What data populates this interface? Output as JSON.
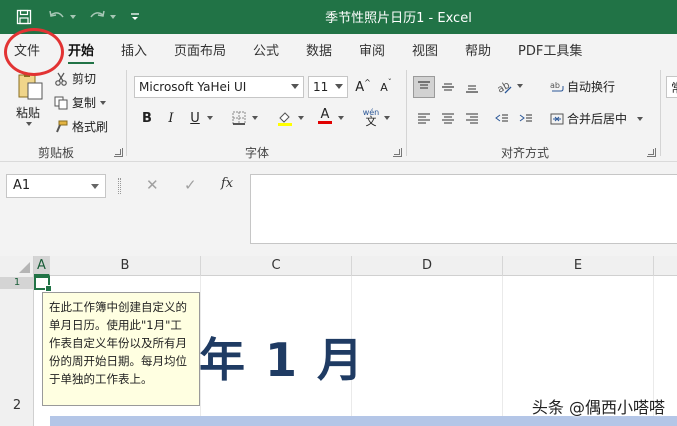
{
  "titlebar": {
    "title": "季节性照片日历1  -  Excel"
  },
  "tabs": [
    "文件",
    "开始",
    "插入",
    "页面布局",
    "公式",
    "数据",
    "审阅",
    "视图",
    "帮助",
    "PDF工具集"
  ],
  "clipboard": {
    "paste": "粘贴",
    "cut": "剪切",
    "copy": "复制",
    "format_painter": "格式刷",
    "group_label": "剪贴板"
  },
  "font": {
    "font_name": "Microsoft YaHei UI",
    "font_size": "11",
    "bold": "B",
    "italic": "I",
    "underline": "U",
    "phonetic": "wén",
    "group_label": "字体"
  },
  "alignment": {
    "wrap_text": "自动换行",
    "merge_center": "合并后居中",
    "group_label": "对齐方式",
    "number_format_partial": "常"
  },
  "formula_bar": {
    "name_box": "A1",
    "fx": "fx"
  },
  "columns": [
    "A",
    "B",
    "C",
    "D",
    "E"
  ],
  "rows": [
    "1",
    "2"
  ],
  "sheet": {
    "heading": "年 1 月",
    "tooltip": "在此工作簿中创建自定义的单月日历。使用此\"1月\"工作表自定义年份以及所有月份的周开始日期。每月均位于单独的工作表上。"
  },
  "watermark": "头条 @偶西小嗒嗒",
  "colors": {
    "excel_green": "#217346",
    "heading_navy": "#1f3b63",
    "tooltip_bg": "#ffffe1",
    "band_blue": "#b4c6e7",
    "annotation_red": "#e23333"
  }
}
